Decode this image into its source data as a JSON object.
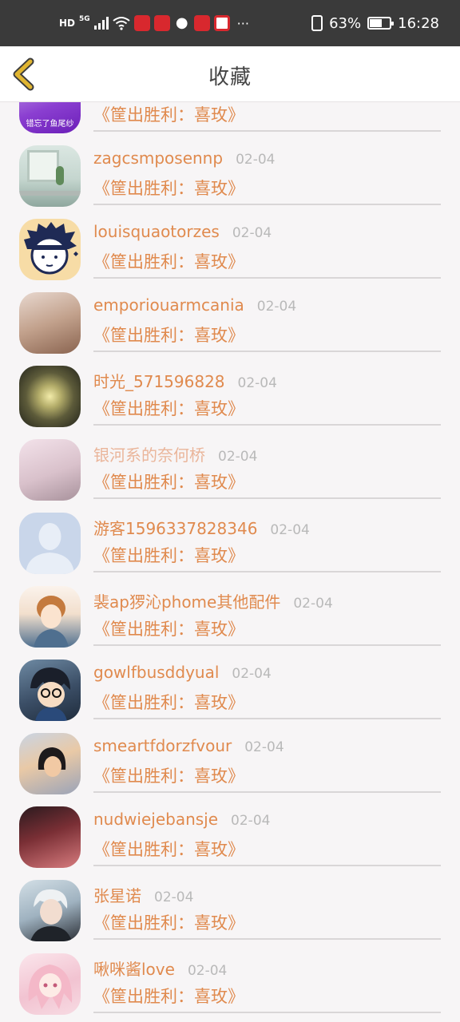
{
  "status_bar": {
    "hd_badge": "HD",
    "network": "5G",
    "battery_percent": "63%",
    "battery_level": 0.63,
    "time": "16:28",
    "more": "···"
  },
  "header": {
    "title": "收藏",
    "back_icon": "chevron-left-icon",
    "accent": "#e0b531"
  },
  "list": {
    "name_color": "#e08a4e",
    "items": [
      {
        "name": "",
        "date": "",
        "title": "《筐出胜利：喜玫》",
        "avatar_caption": "错忘了鱼尾纱"
      },
      {
        "name": "zagcsmposennp",
        "date": "02-04",
        "title": "《筐出胜利：喜玫》"
      },
      {
        "name": "louisquaotorzes",
        "date": "02-04",
        "title": "《筐出胜利：喜玫》"
      },
      {
        "name": "emporiouarmcania",
        "date": "02-04",
        "title": "《筐出胜利：喜玫》"
      },
      {
        "name": "时光_571596828",
        "date": "02-04",
        "title": "《筐出胜利：喜玫》"
      },
      {
        "name": "银河系的奈何桥",
        "date": "02-04",
        "title": "《筐出胜利：喜玫》"
      },
      {
        "name": "游客1596337828346",
        "date": "02-04",
        "title": "《筐出胜利：喜玫》"
      },
      {
        "name": "裴ap猡沁phome其他配件",
        "date": "02-04",
        "title": "《筐出胜利：喜玫》"
      },
      {
        "name": "gowlfbusddyual",
        "date": "02-04",
        "title": "《筐出胜利：喜玫》"
      },
      {
        "name": "smeartfdorzfvour",
        "date": "02-04",
        "title": "《筐出胜利：喜玫》"
      },
      {
        "name": "nudwiejebansje",
        "date": "02-04",
        "title": "《筐出胜利：喜玫》"
      },
      {
        "name": "张星诺",
        "date": "02-04",
        "title": "《筐出胜利：喜玫》"
      },
      {
        "name": "啾咪酱love",
        "date": "02-04",
        "title": "《筐出胜利：喜玫》"
      }
    ]
  }
}
